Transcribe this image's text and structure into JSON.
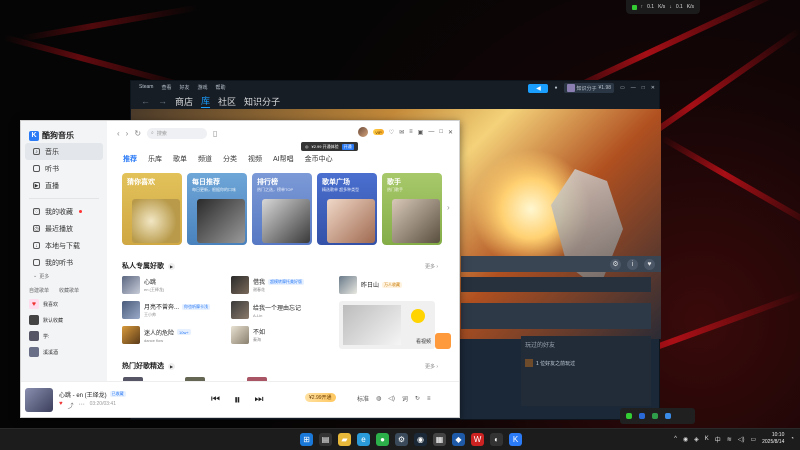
{
  "tray_top": {
    "up_label": "0.1",
    "up_unit": "K/s",
    "down_label": "0.1",
    "down_unit": "K/s"
  },
  "steam": {
    "menu": [
      "Steam",
      "查看",
      "好友",
      "游戏",
      "帮助"
    ],
    "nav": [
      "商店",
      "库",
      "社区",
      "知识分子"
    ],
    "user_name": "知识分子",
    "balance": "¥1.98",
    "friends_title": "玩过的好友",
    "friends_row": "1 位好友之前玩过"
  },
  "kuwo": {
    "app_name": "酷狗音乐",
    "sidebar": {
      "items": [
        {
          "label": "音乐",
          "icon": "music-icon"
        },
        {
          "label": "听书",
          "icon": "book-icon"
        },
        {
          "label": "直播",
          "icon": "live-icon"
        },
        {
          "label": "我的收藏",
          "icon": "heart-icon"
        },
        {
          "label": "最近播放",
          "icon": "clock-icon"
        },
        {
          "label": "本地与下载",
          "icon": "download-icon"
        },
        {
          "label": "我的听书",
          "icon": "headphones-icon"
        }
      ],
      "more": "更多",
      "subtabs": [
        "自建歌单",
        "收藏歌单"
      ],
      "playlists": [
        "我喜欢",
        "默认收藏",
        "学:",
        "溪溪酒"
      ]
    },
    "search_placeholder": "搜索",
    "vip_badge": "VIP",
    "tooltip": {
      "text": "¥2.99 开通体验",
      "tag": "开通"
    },
    "tabs": [
      "推荐",
      "乐库",
      "歌单",
      "频道",
      "分类",
      "视频",
      "AI帮唱",
      "金币中心"
    ],
    "cards": [
      {
        "title": "猜你喜欢",
        "sub": ""
      },
      {
        "title": "每日推荐",
        "sub": "每日更新，根据你的口味"
      },
      {
        "title": "排行榜",
        "sub": "热门之选，榜单TOP"
      },
      {
        "title": "歌单广场",
        "sub": "精选歌单 超多种类型"
      },
      {
        "title": "歌手",
        "sub": "热门歌手"
      }
    ],
    "section1": {
      "title": "私人专属好歌",
      "more": "更多"
    },
    "songs": [
      {
        "title": "心跳",
        "artist": "en (王绎龙)",
        "tag": ""
      },
      {
        "title": "借我",
        "artist": "谢春花",
        "tag": "超模转摩托美好版"
      },
      {
        "title": "昨日山",
        "artist": "",
        "tag": "万人收藏"
      },
      {
        "title": "月亮不曾奔...",
        "artist": "王小帅",
        "tag": "你也听摩卡浅"
      },
      {
        "title": "给我一个理由忘记",
        "artist": "A-Lin",
        "tag": ""
      },
      {
        "title": "迷人的危险",
        "artist": "dance flow",
        "tag": "10w+"
      },
      {
        "title": "不如",
        "artist": "秦海",
        "tag": ""
      }
    ],
    "ad_label": "看视频",
    "section2": {
      "title": "热门好歌精选",
      "more": "更多"
    },
    "player": {
      "title": "心跳 - en (王绎龙)",
      "badge": "已收藏",
      "time": "03:20/03:41",
      "vip": "¥2.99开通",
      "quality": "标准"
    }
  },
  "taskbar": {
    "time": "10:10",
    "date": "2025/8/14",
    "lang": "中"
  }
}
